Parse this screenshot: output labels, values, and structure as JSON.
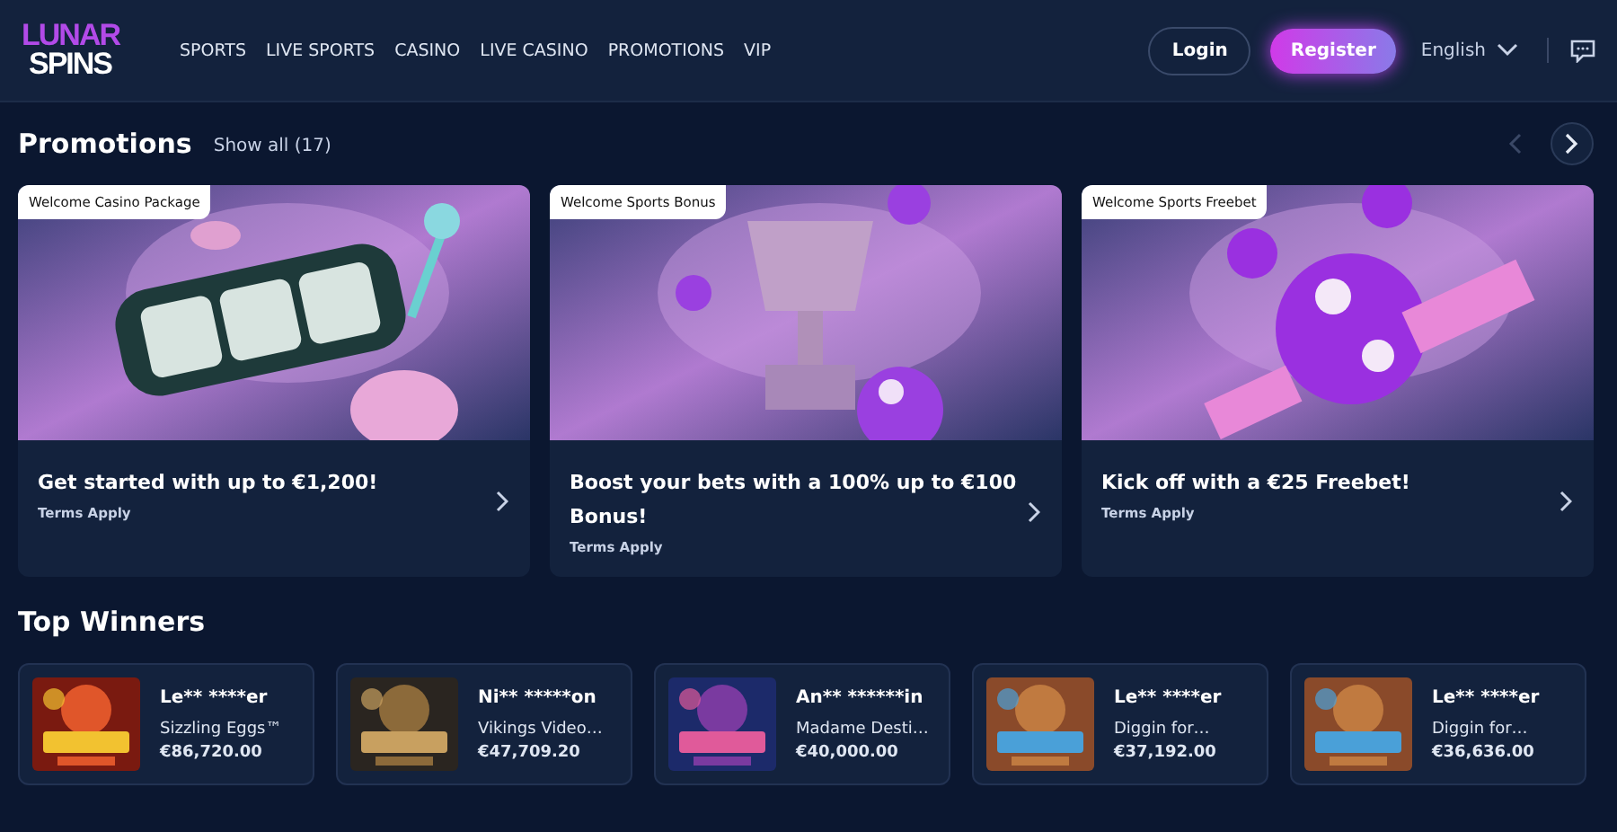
{
  "header": {
    "logo": [
      "LUNAR",
      "SPINS"
    ],
    "nav": [
      "SPORTS",
      "LIVE SPORTS",
      "CASINO",
      "LIVE CASINO",
      "PROMOTIONS",
      "VIP"
    ],
    "login": "Login",
    "register": "Register",
    "language": "English"
  },
  "promotions": {
    "title": "Promotions",
    "show_all": "Show all (17)",
    "cards": [
      {
        "tag": "Welcome Casino Package",
        "title": "Get started with up to €1,200!",
        "terms": "Terms Apply"
      },
      {
        "tag": "Welcome Sports Bonus",
        "title": "Boost your bets with a 100% up to €100 Bonus!",
        "terms": "Terms Apply"
      },
      {
        "tag": "Welcome Sports Freebet",
        "title": "Kick off with a €25 Freebet!",
        "terms": "Terms Apply"
      }
    ]
  },
  "top_winners": {
    "title": "Top Winners",
    "items": [
      {
        "name": "Le** ****er",
        "game": "Sizzling Eggs™",
        "amount": "€86,720.00"
      },
      {
        "name": "Ni** *****on",
        "game": "Vikings Video…",
        "amount": "€47,709.20"
      },
      {
        "name": "An** ******in",
        "game": "Madame Desti…",
        "amount": "€40,000.00"
      },
      {
        "name": "Le** ****er",
        "game": "Diggin for…",
        "amount": "€37,192.00"
      },
      {
        "name": "Le** ****er",
        "game": "Diggin for…",
        "amount": "€36,636.00"
      }
    ]
  }
}
